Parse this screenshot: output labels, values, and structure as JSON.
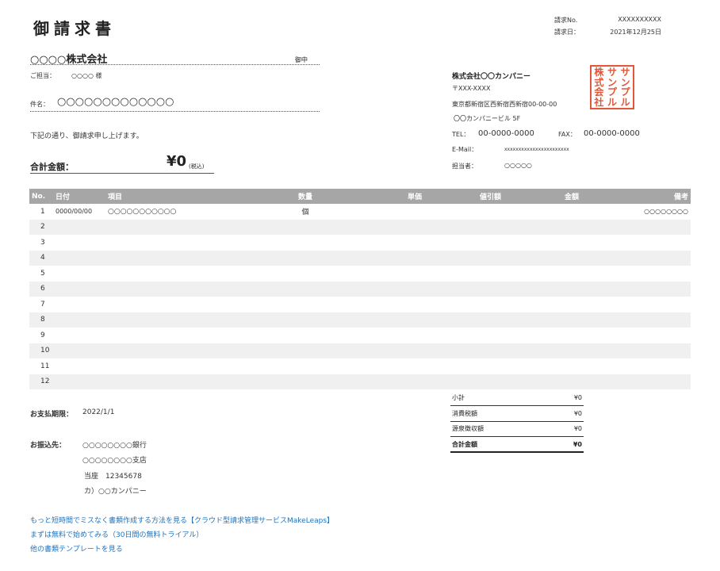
{
  "title": "御請求書",
  "meta": {
    "invoice_no_label": "請求No.",
    "invoice_no": "XXXXXXXXXX",
    "date_label": "請求日：",
    "date": "2021年12月25日"
  },
  "client": {
    "name": "○○○○株式会社",
    "honorific": "御中",
    "contact_label": "ご担当：",
    "contact": "○○○○ 様",
    "subject_label": "件名：",
    "subject": "○○○○○○○○○○○○○",
    "message": "下記の通り、御請求申し上げます。",
    "total_label": "合計金額：",
    "total_value": "¥0",
    "total_tax": "(税込)"
  },
  "company": {
    "name": "株式会社〇〇カンパニー",
    "postal": "〒XXX-XXXX",
    "address1": "東京都新宿区西新宿西新宿00-00-00",
    "address2": "〇〇カンパニービル 5F",
    "tel_label": "TEL：",
    "tel": "00-0000-0000",
    "fax_label": "FAX：",
    "fax": "00-0000-0000",
    "email_label": "E-Mail：",
    "email": "xxxxxxxxxxxxxxxxxxxxxxx",
    "person_label": "担当者：",
    "person": "○○○○○",
    "seal_chars": [
      "株",
      "サ",
      "サ",
      "式",
      "ン",
      "ン",
      "会",
      "プ",
      "プ",
      "社",
      "ル",
      "ル"
    ]
  },
  "table": {
    "headers": [
      "No.",
      "日付",
      "項目",
      "数量",
      "単価",
      "値引額",
      "金額",
      "備考"
    ],
    "rows": [
      {
        "no": "1",
        "date": "0000/00/00",
        "item": "○○○○○○○○○○○",
        "qty": "個",
        "price": "",
        "discount": "",
        "amount": "",
        "note": "○○○○○○○○"
      },
      {
        "no": "2",
        "date": "",
        "item": "",
        "qty": "",
        "price": "",
        "discount": "",
        "amount": "",
        "note": ""
      },
      {
        "no": "3",
        "date": "",
        "item": "",
        "qty": "",
        "price": "",
        "discount": "",
        "amount": "",
        "note": ""
      },
      {
        "no": "4",
        "date": "",
        "item": "",
        "qty": "",
        "price": "",
        "discount": "",
        "amount": "",
        "note": ""
      },
      {
        "no": "5",
        "date": "",
        "item": "",
        "qty": "",
        "price": "",
        "discount": "",
        "amount": "",
        "note": ""
      },
      {
        "no": "6",
        "date": "",
        "item": "",
        "qty": "",
        "price": "",
        "discount": "",
        "amount": "",
        "note": ""
      },
      {
        "no": "7",
        "date": "",
        "item": "",
        "qty": "",
        "price": "",
        "discount": "",
        "amount": "",
        "note": ""
      },
      {
        "no": "8",
        "date": "",
        "item": "",
        "qty": "",
        "price": "",
        "discount": "",
        "amount": "",
        "note": ""
      },
      {
        "no": "9",
        "date": "",
        "item": "",
        "qty": "",
        "price": "",
        "discount": "",
        "amount": "",
        "note": ""
      },
      {
        "no": "10",
        "date": "",
        "item": "",
        "qty": "",
        "price": "",
        "discount": "",
        "amount": "",
        "note": ""
      },
      {
        "no": "11",
        "date": "",
        "item": "",
        "qty": "",
        "price": "",
        "discount": "",
        "amount": "",
        "note": ""
      },
      {
        "no": "12",
        "date": "",
        "item": "",
        "qty": "",
        "price": "",
        "discount": "",
        "amount": "",
        "note": ""
      }
    ]
  },
  "summary": [
    {
      "label": "小計",
      "value": "¥0"
    },
    {
      "label": "消費税額",
      "value": "¥0"
    },
    {
      "label": "源泉徴収額",
      "value": "¥0"
    },
    {
      "label": "合計金額",
      "value": "¥0"
    }
  ],
  "payment": {
    "due_label": "お支払期限：",
    "due": "2022/1/1",
    "bank_label": "お振込先：",
    "bank": "○○○○○○○○銀行",
    "branch": "○○○○○○○○支店",
    "account": "当座　12345678",
    "holder": "カ）○○カンパニー"
  },
  "links": [
    "もっと短時間でミスなく書類作成する方法を見る【クラウド型請求管理サービスMakeLeaps】",
    "まずは無料で始めてみる（30日間の無料トライアル）",
    "他の書類テンプレートを見る"
  ]
}
